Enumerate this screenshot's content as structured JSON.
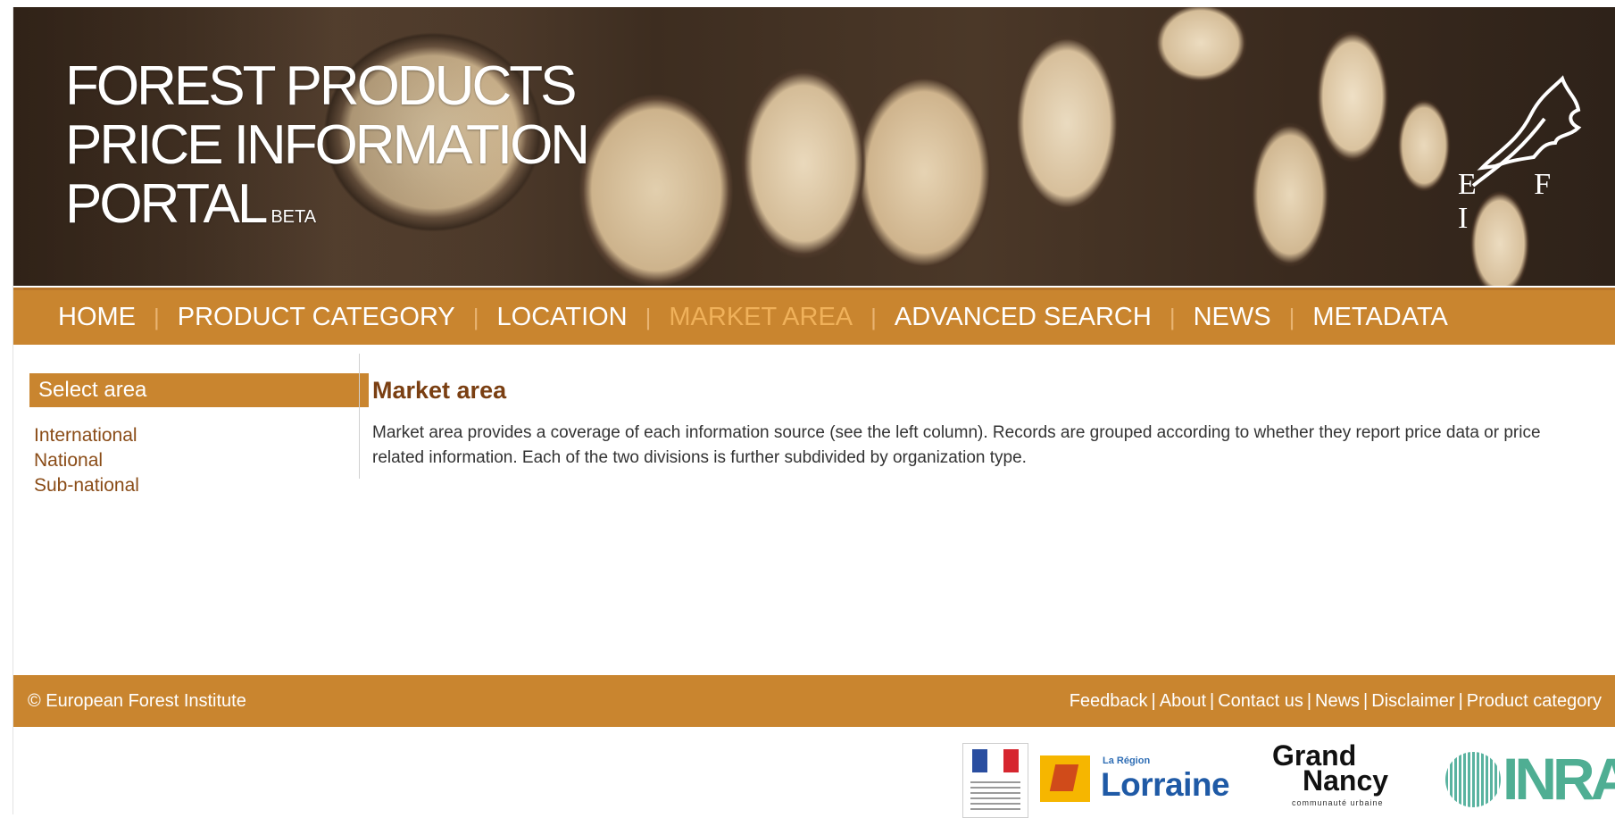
{
  "header": {
    "title_lines": [
      "FOREST PRODUCTS",
      "PRICE INFORMATION",
      "PORTAL"
    ],
    "beta_label": "BETA",
    "org_logo_text": "E F I",
    "org_logo_icon": "oak-leaf-icon"
  },
  "nav": {
    "items": [
      {
        "label": "HOME"
      },
      {
        "label": "PRODUCT CATEGORY"
      },
      {
        "label": "LOCATION"
      },
      {
        "label": "MARKET AREA",
        "active": true
      },
      {
        "label": "ADVANCED SEARCH"
      },
      {
        "label": "NEWS"
      },
      {
        "label": "METADATA"
      }
    ],
    "separator": "|"
  },
  "sidebar": {
    "header": "Select area",
    "items": [
      {
        "label": "International"
      },
      {
        "label": "National"
      },
      {
        "label": "Sub-national"
      }
    ]
  },
  "main": {
    "title": "Market area",
    "text": "Market area provides a coverage of each information source (see the left column). Records are grouped according to whether they report price data or price related information. Each of the two divisions is further subdivided by organization type."
  },
  "footer": {
    "copyright": "© European Forest Institute",
    "links": [
      {
        "label": "Feedback"
      },
      {
        "label": "About"
      },
      {
        "label": "Contact us"
      },
      {
        "label": "News"
      },
      {
        "label": "Disclaimer"
      },
      {
        "label": "Product category"
      }
    ],
    "separator": "|"
  },
  "sponsors": {
    "lorraine_small": "La Région",
    "lorraine_big": "Lorraine",
    "grandnancy_line1": "Grand",
    "grandnancy_line2": "Nancy",
    "grandnancy_tagline": "communauté urbaine",
    "inra": "INRA"
  },
  "colors": {
    "accent": "#c9852f",
    "active_nav": "#f0b15a",
    "link": "#8a4c17",
    "heading": "#7a3f12"
  }
}
